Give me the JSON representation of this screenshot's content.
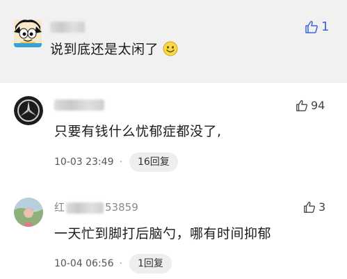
{
  "comments": [
    {
      "username_prefix": "",
      "username_suffix": "",
      "text": "说到底还是太闲了",
      "likes": "1",
      "emoji_icon": "smiling-face-icon"
    },
    {
      "username_prefix": "",
      "username_suffix": "",
      "text": "只要有钱什么忧郁症都没了,",
      "likes": "94",
      "timestamp": "10-03 23:49",
      "dot": "·",
      "replies": "16回复",
      "avatar_icon": "mercedes-logo-icon"
    },
    {
      "username_prefix": "红",
      "username_suffix": "53859",
      "text": "一天忙到脚打后脑勺，哪有时间抑郁",
      "likes": "3",
      "timestamp": "10-04 06:56",
      "dot": "·",
      "replies": "1回复"
    }
  ],
  "colors": {
    "highlight_bg": "#f1f1f1",
    "text": "#1a1a1a",
    "meta": "#555555",
    "pill_bg": "#eeeeee"
  }
}
